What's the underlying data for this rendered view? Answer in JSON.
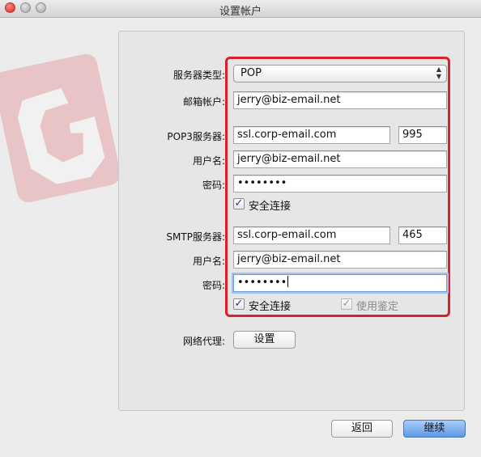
{
  "window": {
    "title": "设置帐户"
  },
  "form": {
    "server_type_label": "服务器类型:",
    "server_type_value": "POP",
    "email_account_label": "邮箱帐户:",
    "email_account_value": "jerry@biz-email.net",
    "pop3": {
      "server_label": "POP3服务器:",
      "server_value": "ssl.corp-email.com",
      "port_value": "995",
      "username_label": "用户名:",
      "username_value": "jerry@biz-email.net",
      "password_label": "密码:",
      "password_value": "••••••••",
      "secure_label": "安全连接",
      "secure_checked": true
    },
    "smtp": {
      "server_label": "SMTP服务器:",
      "server_value": "ssl.corp-email.com",
      "port_value": "465",
      "username_label": "用户名:",
      "username_value": "jerry@biz-email.net",
      "password_label": "密码:",
      "password_value": "••••••••",
      "secure_label": "安全连接",
      "secure_checked": true,
      "auth_label": "使用鉴定",
      "auth_checked": true,
      "auth_disabled": true
    },
    "proxy_label": "网络代理:",
    "proxy_button": "设置"
  },
  "footer": {
    "back_button": "返回",
    "continue_button": "继续"
  },
  "colors": {
    "highlight": "#d9202c",
    "primary_button": "#5d9ae6",
    "logo": "#e0606a"
  }
}
